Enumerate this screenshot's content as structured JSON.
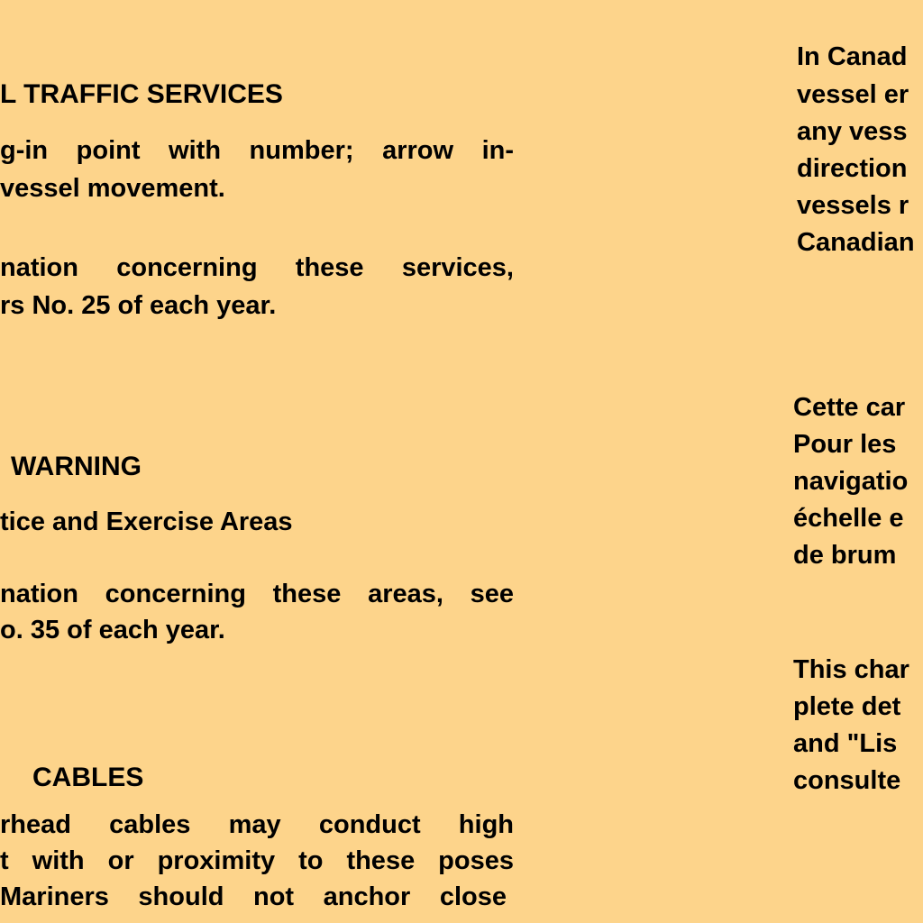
{
  "left_column": {
    "vts_heading": "L TRAFFIC SERVICES",
    "vts_line1": "g-in point with number; arrow in-",
    "vts_line2": "vessel movement.",
    "vts_line3": "nation concerning these services,",
    "vts_line4": "rs No. 25 of each year.",
    "warning_heading": "WARNING",
    "warning_line1": "tice and Exercise Areas",
    "warning_line2": "nation concerning these areas, see",
    "warning_line3": "o. 35 of each year.",
    "cables_heading": "CABLES",
    "cables_line1": "rhead cables may conduct high",
    "cables_line2": "t with or proximity to these poses",
    "cables_line3": "Mariners should not anchor close"
  },
  "right_column": {
    "p1_line1": "In Canad",
    "p1_line2": "vessel er",
    "p1_line3": "any vess",
    "p1_line4": "direction",
    "p1_line5": "vessels r",
    "p1_line6": "Canadian",
    "p2_line1": "Cette car",
    "p2_line2": "Pour les",
    "p2_line3": "navigatio",
    "p2_line4": "échelle e",
    "p2_line5": "de brum",
    "p3_line1": "This char",
    "p3_line2": "plete det",
    "p3_line3": "and \"Lis",
    "p3_line4": "consulte"
  }
}
